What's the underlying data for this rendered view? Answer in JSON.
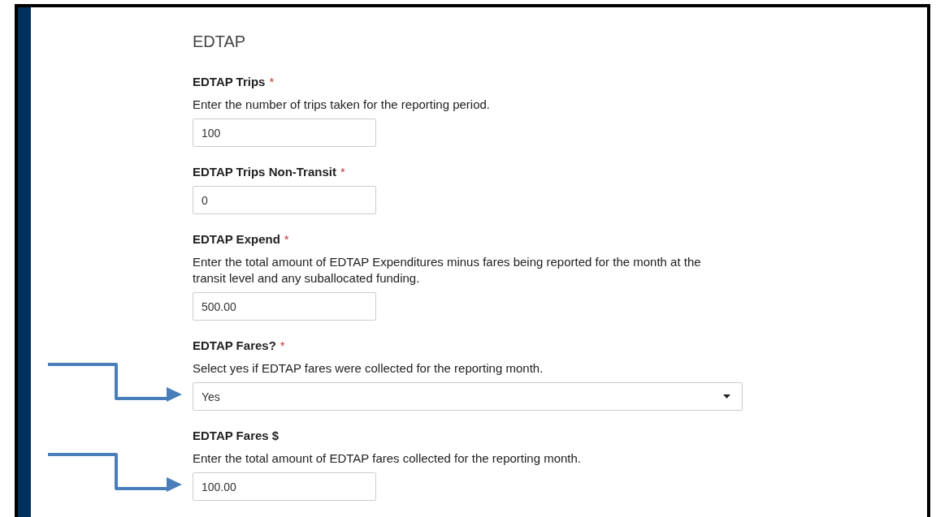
{
  "section_title": "EDTAP",
  "fields": [
    {
      "kind": "text",
      "label": "EDTAP Trips",
      "required": true,
      "description": "Enter the number of trips taken for the reporting period.",
      "value": "100",
      "annotated": false
    },
    {
      "kind": "text",
      "label": "EDTAP Trips Non-Transit",
      "required": true,
      "value": "0",
      "annotated": false
    },
    {
      "kind": "text",
      "label": "EDTAP Expend",
      "required": true,
      "description": "Enter the total amount of EDTAP Expenditures minus fares being reported for the month at the transit level and any suballocated funding.",
      "value": "500.00",
      "annotated": false
    },
    {
      "kind": "select",
      "label": "EDTAP Fares?",
      "required": true,
      "description": "Select yes if EDTAP fares were collected for the reporting month.",
      "value": "Yes",
      "annotated": true
    },
    {
      "kind": "text",
      "label": "EDTAP Fares $",
      "required": false,
      "description": "Enter the total amount of EDTAP fares collected for the reporting month.",
      "value": "100.00",
      "annotated": true
    }
  ],
  "required_mark": "*"
}
